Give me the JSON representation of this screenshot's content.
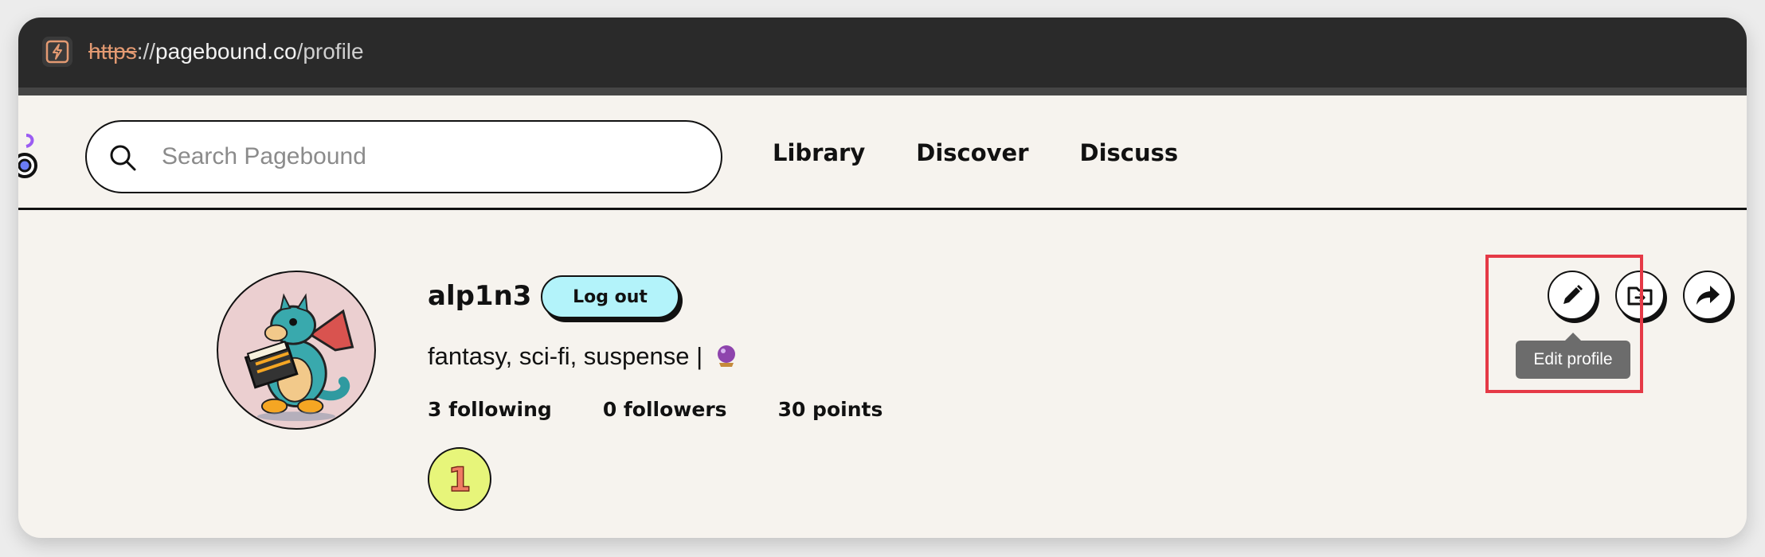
{
  "browser": {
    "url_protocol": "https",
    "url_separator": "://",
    "url_host": "pagebound.co",
    "url_path": "/profile",
    "site_icon": "bolt-icon"
  },
  "navbar": {
    "search_placeholder": "Search Pagebound",
    "search_value": "",
    "links": [
      {
        "label": "Library"
      },
      {
        "label": "Discover"
      },
      {
        "label": "Discuss"
      }
    ]
  },
  "profile": {
    "username": "alp1n3",
    "logout_label": "Log out",
    "bio_text": "fantasy, sci-fi, suspense |",
    "bio_emoji": "crystal-ball-icon",
    "following": "3 following",
    "followers": "0 followers",
    "points": "30 points",
    "badge_value": "1",
    "avatar": "dragon-reading-book-avatar"
  },
  "actions": {
    "edit_icon": "pencil-icon",
    "folder_icon": "folder-arrow-icon",
    "share_icon": "share-arrow-icon",
    "tooltip": "Edit profile"
  },
  "colors": {
    "page_bg": "#f6f3ee",
    "urlbar_bg": "#2a2a2a",
    "logout_bg": "#b3f3fa",
    "avatar_bg": "#ebcfd0",
    "badge_bg": "#e7f57a",
    "highlight": "#e53946"
  }
}
